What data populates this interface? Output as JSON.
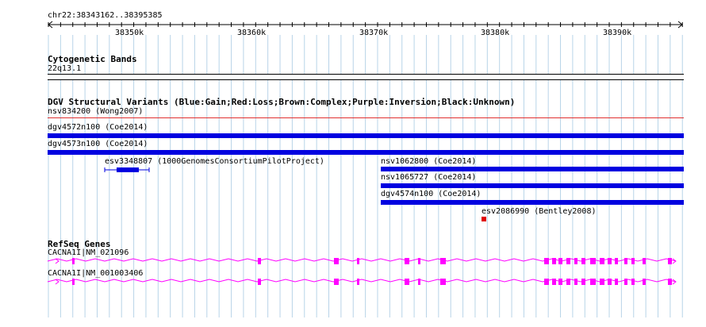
{
  "ruler": {
    "location": "chr22:38343162..38395385",
    "ticks": [
      "38350k",
      "38360k",
      "38370k",
      "38380k",
      "38390k"
    ]
  },
  "tracks": {
    "cytoband": {
      "title": "Cytogenetic Bands",
      "band": "22q13.1"
    },
    "dgv": {
      "title": "DGV Structural Variants (Blue:Gain;Red:Loss;Brown:Complex;Purple:Inversion;Black:Unknown)",
      "features": [
        {
          "label": "nsv834200 (Wong2007)",
          "color": "#e03030"
        },
        {
          "label": "dgv4572n100 (Coe2014)",
          "color": "#0000e0"
        },
        {
          "label": "dgv4573n100 (Coe2014)",
          "color": "#0000e0"
        },
        {
          "label": "esv3348807 (1000GenomesConsortiumPilotProject)",
          "color": "#0000e0"
        },
        {
          "label": "nsv1062800 (Coe2014)",
          "color": "#0000e0"
        },
        {
          "label": "nsv1065727 (Coe2014)",
          "color": "#0000e0"
        },
        {
          "label": "dgv4574n100 (Coe2014)",
          "color": "#0000e0"
        },
        {
          "label": "esv2086990 (Bentley2008)",
          "color": "#e00000"
        }
      ]
    },
    "refseq": {
      "title": "RefSeq Genes",
      "color": "#ff00ff",
      "transcripts": [
        {
          "label": "CACNA1I|NM_021096"
        },
        {
          "label": "CACNA1I|NM_001003406"
        }
      ]
    }
  },
  "colors": {
    "gridline": "#b8d4e8",
    "ruler": "#000000"
  }
}
